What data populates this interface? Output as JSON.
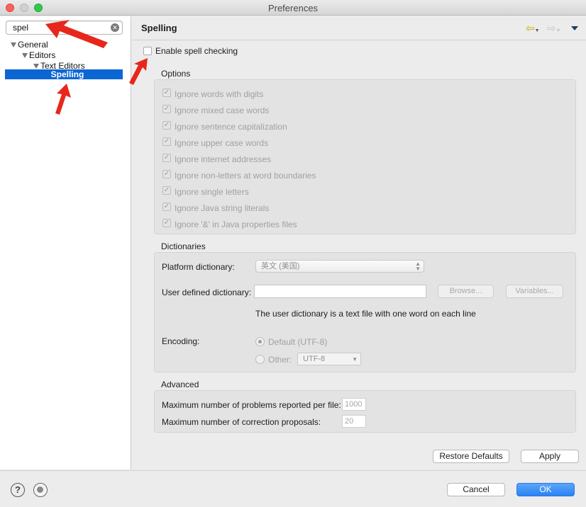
{
  "window": {
    "title": "Preferences"
  },
  "sidebar": {
    "search_value": "spel",
    "tree": [
      {
        "label": "General"
      },
      {
        "label": "Editors"
      },
      {
        "label": "Text Editors"
      },
      {
        "label": "Spelling"
      }
    ]
  },
  "page": {
    "title": "Spelling",
    "enable_label": "Enable spell checking",
    "options": {
      "title": "Options",
      "items": [
        "Ignore words with digits",
        "Ignore mixed case words",
        "Ignore sentence capitalization",
        "Ignore upper case words",
        "Ignore internet addresses",
        "Ignore non-letters at word boundaries",
        "Ignore single letters",
        "Ignore Java string literals",
        "Ignore '&' in Java properties files"
      ]
    },
    "dictionaries": {
      "title": "Dictionaries",
      "platform_label": "Platform dictionary:",
      "platform_value": "英文 (美国)",
      "user_label": "User defined dictionary:",
      "user_value": "",
      "browse_label": "Browse...",
      "variables_label": "Variables...",
      "hint": "The user dictionary is a text file with one word on each line",
      "encoding_label": "Encoding:",
      "default_label": "Default (UTF-8)",
      "other_label": "Other:",
      "other_value": "UTF-8"
    },
    "advanced": {
      "title": "Advanced",
      "max_problems_label": "Maximum number of problems reported per file:",
      "max_problems_value": "1000",
      "max_proposals_label": "Maximum number of correction proposals:",
      "max_proposals_value": "20"
    },
    "restore_label": "Restore Defaults",
    "apply_label": "Apply"
  },
  "footer": {
    "help_glyph": "?",
    "cancel_label": "Cancel",
    "ok_label": "OK"
  },
  "icons": {
    "help": "help-icon",
    "prefs": "preferences-icon",
    "back": "back-arrow-icon",
    "forward": "forward-arrow-icon",
    "menu": "view-menu-icon",
    "clear": "clear-search-icon"
  },
  "colors": {
    "selection": "#0b66d4",
    "ok_button": "#2b82f2",
    "annotation_arrow": "#e8271c"
  }
}
